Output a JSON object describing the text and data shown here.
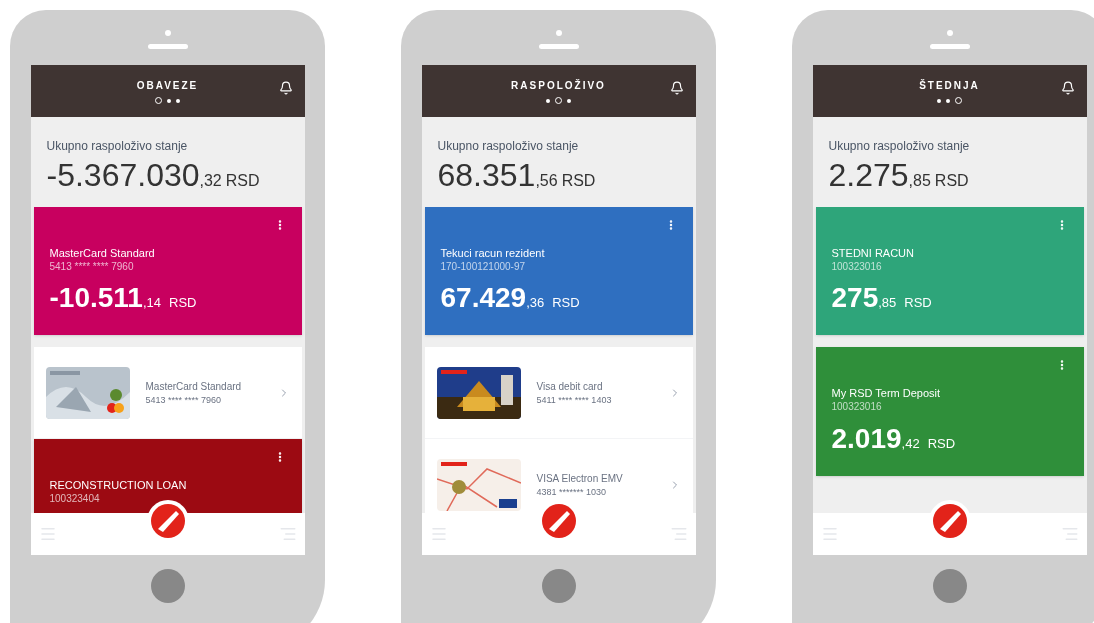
{
  "phones": [
    {
      "title": "OBAVEZE",
      "page_dots": [
        {
          "selected": true
        },
        {
          "selected": false
        },
        {
          "selected": false
        }
      ],
      "total_label": "Ukupno raspoloživo stanje",
      "total_amount": "-5.367.030",
      "total_decimals": ",32",
      "total_currency": "RSD",
      "items": [
        {
          "kind": "account",
          "name": "MasterCard Standard",
          "number": "5413 **** **** 7960",
          "amount": "-10.511",
          "decimals": ",14",
          "currency": "RSD",
          "color": "#c8005f"
        },
        {
          "kind": "card",
          "name": "MasterCard Standard",
          "number": "5413 **** **** 7960"
        },
        {
          "kind": "account",
          "name": "RECONSTRUCTION LOAN",
          "number": "100323404",
          "color": "#9c0a12"
        }
      ]
    },
    {
      "title": "RASPOLOŽIVO",
      "page_dots": [
        {
          "selected": false
        },
        {
          "selected": true
        },
        {
          "selected": false
        }
      ],
      "total_label": "Ukupno raspoloživo stanje",
      "total_amount": "68.351",
      "total_decimals": ",56",
      "total_currency": "RSD",
      "items": [
        {
          "kind": "account",
          "name": "Tekuci racun rezident",
          "number": "170-100121000-97",
          "amount": "67.429",
          "decimals": ",36",
          "currency": "RSD",
          "color": "#2f6fc0"
        },
        {
          "kind": "card",
          "name": "Visa debit card",
          "number": "5411 **** **** 1403"
        },
        {
          "kind": "card",
          "name": "VISA Electron EMV",
          "number": "4381 ******* 1030"
        }
      ]
    },
    {
      "title": "ŠTEDNJA",
      "page_dots": [
        {
          "selected": false
        },
        {
          "selected": false
        },
        {
          "selected": true
        }
      ],
      "total_label": "Ukupno raspoloživo stanje",
      "total_amount": "2.275",
      "total_decimals": ",85",
      "total_currency": "RSD",
      "items": [
        {
          "kind": "account",
          "name": "STEDNI RACUN",
          "number": "100323016",
          "amount": "275",
          "decimals": ",85",
          "currency": "RSD",
          "color": "#2ea57a"
        },
        {
          "kind": "account",
          "name": "My RSD Term Deposit",
          "number": "100323016",
          "amount": "2.019",
          "decimals": ",42",
          "currency": "RSD",
          "color": "#2f8f3a"
        }
      ]
    }
  ]
}
